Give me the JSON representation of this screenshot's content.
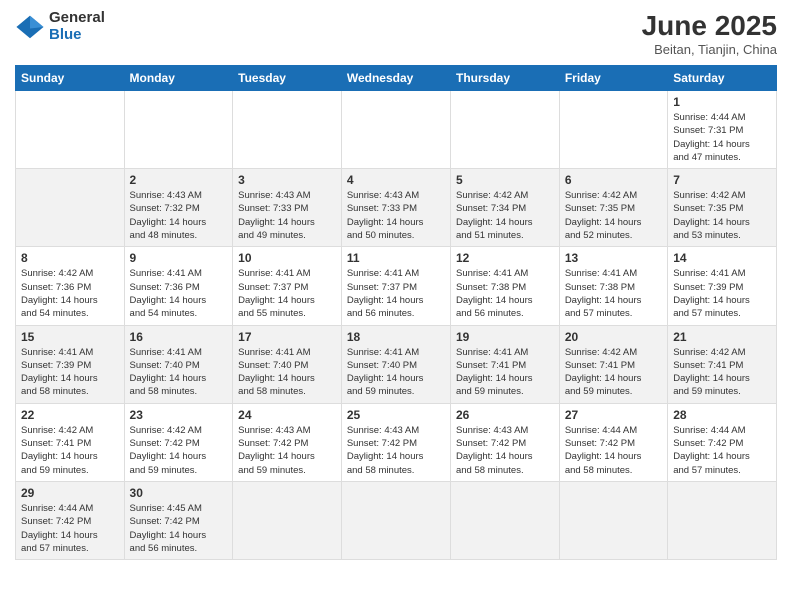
{
  "header": {
    "logo": {
      "general": "General",
      "blue": "Blue"
    },
    "title": "June 2025",
    "subtitle": "Beitan, Tianjin, China"
  },
  "calendar": {
    "days_of_week": [
      "Sunday",
      "Monday",
      "Tuesday",
      "Wednesday",
      "Thursday",
      "Friday",
      "Saturday"
    ],
    "weeks": [
      [
        {
          "day": "",
          "info": ""
        },
        {
          "day": "",
          "info": ""
        },
        {
          "day": "",
          "info": ""
        },
        {
          "day": "",
          "info": ""
        },
        {
          "day": "",
          "info": ""
        },
        {
          "day": "",
          "info": ""
        },
        {
          "day": "1",
          "info": "Sunrise: 4:44 AM\nSunset: 7:31 PM\nDaylight: 14 hours\nand 47 minutes."
        }
      ],
      [
        {
          "day": "2",
          "info": "Sunrise: 4:43 AM\nSunset: 7:32 PM\nDaylight: 14 hours\nand 48 minutes."
        },
        {
          "day": "3",
          "info": "Sunrise: 4:43 AM\nSunset: 7:33 PM\nDaylight: 14 hours\nand 49 minutes."
        },
        {
          "day": "4",
          "info": "Sunrise: 4:43 AM\nSunset: 7:33 PM\nDaylight: 14 hours\nand 50 minutes."
        },
        {
          "day": "5",
          "info": "Sunrise: 4:42 AM\nSunset: 7:34 PM\nDaylight: 14 hours\nand 51 minutes."
        },
        {
          "day": "6",
          "info": "Sunrise: 4:42 AM\nSunset: 7:35 PM\nDaylight: 14 hours\nand 52 minutes."
        },
        {
          "day": "7",
          "info": "Sunrise: 4:42 AM\nSunset: 7:35 PM\nDaylight: 14 hours\nand 53 minutes."
        }
      ],
      [
        {
          "day": "8",
          "info": "Sunrise: 4:42 AM\nSunset: 7:36 PM\nDaylight: 14 hours\nand 54 minutes."
        },
        {
          "day": "9",
          "info": "Sunrise: 4:41 AM\nSunset: 7:36 PM\nDaylight: 14 hours\nand 54 minutes."
        },
        {
          "day": "10",
          "info": "Sunrise: 4:41 AM\nSunset: 7:37 PM\nDaylight: 14 hours\nand 55 minutes."
        },
        {
          "day": "11",
          "info": "Sunrise: 4:41 AM\nSunset: 7:37 PM\nDaylight: 14 hours\nand 56 minutes."
        },
        {
          "day": "12",
          "info": "Sunrise: 4:41 AM\nSunset: 7:38 PM\nDaylight: 14 hours\nand 56 minutes."
        },
        {
          "day": "13",
          "info": "Sunrise: 4:41 AM\nSunset: 7:38 PM\nDaylight: 14 hours\nand 57 minutes."
        },
        {
          "day": "14",
          "info": "Sunrise: 4:41 AM\nSunset: 7:39 PM\nDaylight: 14 hours\nand 57 minutes."
        }
      ],
      [
        {
          "day": "15",
          "info": "Sunrise: 4:41 AM\nSunset: 7:39 PM\nDaylight: 14 hours\nand 58 minutes."
        },
        {
          "day": "16",
          "info": "Sunrise: 4:41 AM\nSunset: 7:40 PM\nDaylight: 14 hours\nand 58 minutes."
        },
        {
          "day": "17",
          "info": "Sunrise: 4:41 AM\nSunset: 7:40 PM\nDaylight: 14 hours\nand 58 minutes."
        },
        {
          "day": "18",
          "info": "Sunrise: 4:41 AM\nSunset: 7:40 PM\nDaylight: 14 hours\nand 59 minutes."
        },
        {
          "day": "19",
          "info": "Sunrise: 4:41 AM\nSunset: 7:41 PM\nDaylight: 14 hours\nand 59 minutes."
        },
        {
          "day": "20",
          "info": "Sunrise: 4:42 AM\nSunset: 7:41 PM\nDaylight: 14 hours\nand 59 minutes."
        },
        {
          "day": "21",
          "info": "Sunrise: 4:42 AM\nSunset: 7:41 PM\nDaylight: 14 hours\nand 59 minutes."
        }
      ],
      [
        {
          "day": "22",
          "info": "Sunrise: 4:42 AM\nSunset: 7:41 PM\nDaylight: 14 hours\nand 59 minutes."
        },
        {
          "day": "23",
          "info": "Sunrise: 4:42 AM\nSunset: 7:42 PM\nDaylight: 14 hours\nand 59 minutes."
        },
        {
          "day": "24",
          "info": "Sunrise: 4:43 AM\nSunset: 7:42 PM\nDaylight: 14 hours\nand 59 minutes."
        },
        {
          "day": "25",
          "info": "Sunrise: 4:43 AM\nSunset: 7:42 PM\nDaylight: 14 hours\nand 58 minutes."
        },
        {
          "day": "26",
          "info": "Sunrise: 4:43 AM\nSunset: 7:42 PM\nDaylight: 14 hours\nand 58 minutes."
        },
        {
          "day": "27",
          "info": "Sunrise: 4:44 AM\nSunset: 7:42 PM\nDaylight: 14 hours\nand 58 minutes."
        },
        {
          "day": "28",
          "info": "Sunrise: 4:44 AM\nSunset: 7:42 PM\nDaylight: 14 hours\nand 57 minutes."
        }
      ],
      [
        {
          "day": "29",
          "info": "Sunrise: 4:44 AM\nSunset: 7:42 PM\nDaylight: 14 hours\nand 57 minutes."
        },
        {
          "day": "30",
          "info": "Sunrise: 4:45 AM\nSunset: 7:42 PM\nDaylight: 14 hours\nand 56 minutes."
        },
        {
          "day": "",
          "info": ""
        },
        {
          "day": "",
          "info": ""
        },
        {
          "day": "",
          "info": ""
        },
        {
          "day": "",
          "info": ""
        },
        {
          "day": "",
          "info": ""
        }
      ]
    ]
  }
}
